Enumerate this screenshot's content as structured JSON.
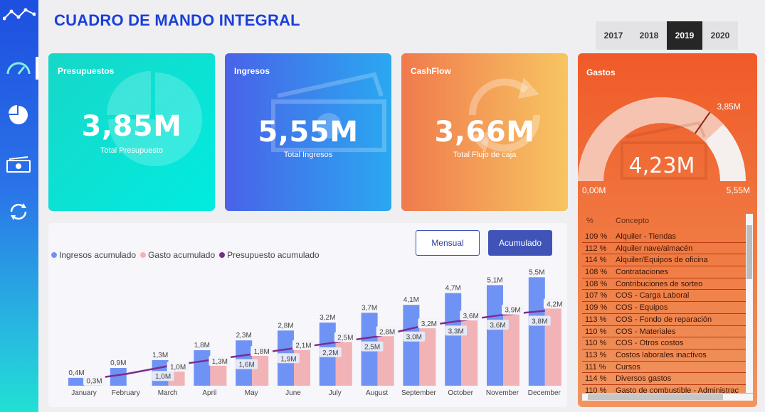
{
  "title": "CUADRO DE MANDO INTEGRAL",
  "years": [
    {
      "label": "2017",
      "active": false
    },
    {
      "label": "2018",
      "active": false
    },
    {
      "label": "2019",
      "active": true
    },
    {
      "label": "2020",
      "active": false
    }
  ],
  "sidebar": {
    "items": [
      {
        "icon": "line-chart-icon"
      },
      {
        "icon": "gauge-icon"
      },
      {
        "icon": "pie-chart-icon"
      },
      {
        "icon": "money-icon"
      },
      {
        "icon": "refresh-icon"
      }
    ]
  },
  "cards": {
    "presupuestos": {
      "title": "Presupuestos",
      "value": "3,85M",
      "subtitle": "Total Presupuesto",
      "icon": "pie-chart-icon"
    },
    "ingresos": {
      "title": "Ingresos",
      "value": "5,55M",
      "subtitle": "Total Ingresos",
      "icon": "money-icon"
    },
    "cashflow": {
      "title": "CashFlow",
      "value": "3,66M",
      "subtitle": "Total Flujo de caja",
      "icon": "refresh-icon"
    }
  },
  "gastos": {
    "title": "Gastos",
    "value": "4,23M",
    "min": "0,00M",
    "max": "5,55M",
    "target": "3,85M",
    "gauge": {
      "value": 4.23,
      "min": 0,
      "max": 5.55,
      "target": 3.85
    },
    "table": {
      "headers": [
        "%",
        "Concepto"
      ],
      "rows": [
        {
          "pct": "109 %",
          "concept": "Alquiler - Tiendas"
        },
        {
          "pct": "112 %",
          "concept": "Alquiler nave/almacén"
        },
        {
          "pct": "114 %",
          "concept": "Alquiler/Equipos de oficina"
        },
        {
          "pct": "108 %",
          "concept": "Contrataciones"
        },
        {
          "pct": "108 %",
          "concept": "Contribuciones de sorteo"
        },
        {
          "pct": "107 %",
          "concept": "COS - Carga Laboral"
        },
        {
          "pct": "109 %",
          "concept": "COS - Equipos"
        },
        {
          "pct": "113 %",
          "concept": "COS - Fondo de reparación"
        },
        {
          "pct": "110 %",
          "concept": "COS - Materiales"
        },
        {
          "pct": "110 %",
          "concept": "COS - Otros costos"
        },
        {
          "pct": "113 %",
          "concept": "Costos laborales inactivos"
        },
        {
          "pct": "111 %",
          "concept": "Cursos"
        },
        {
          "pct": "114 %",
          "concept": "Diversos gastos"
        },
        {
          "pct": "110 %",
          "concept": "Gasto de combustible - Administrac"
        }
      ]
    }
  },
  "chart_controls": {
    "mensual": "Mensual",
    "acumulado": "Acumulado",
    "active": "Acumulado"
  },
  "colors": {
    "ingresos": "#6f93f5",
    "gasto": "#f2b3b6",
    "presupuesto": "#7b2d8e"
  },
  "chart_data": {
    "type": "bar",
    "categories": [
      "January",
      "February",
      "March",
      "April",
      "May",
      "June",
      "July",
      "August",
      "September",
      "October",
      "November",
      "December"
    ],
    "series": [
      {
        "name": "Ingresos acumulado",
        "type": "bar",
        "values": [
          0.4,
          0.9,
          1.3,
          1.8,
          2.3,
          2.8,
          3.2,
          3.7,
          4.1,
          4.7,
          5.1,
          5.5
        ],
        "labels": [
          "0,4M",
          "0,9M",
          "1,3M",
          "1,8M",
          "2,3M",
          "2,8M",
          "3,2M",
          "3,7M",
          "4,1M",
          "4,7M",
          "5,1M",
          "5,5M"
        ]
      },
      {
        "name": "Gasto acumulado",
        "type": "bar",
        "values": [
          0.3,
          null,
          1.0,
          1.3,
          1.8,
          2.1,
          2.5,
          2.8,
          3.2,
          3.6,
          3.9,
          4.2
        ],
        "labels": [
          "0,3M",
          "",
          "1,0M",
          "1,3M",
          "1,8M",
          "2,1M",
          "2,5M",
          "2,8M",
          "3,2M",
          "3,6M",
          "3,9M",
          "4,2M"
        ]
      },
      {
        "name": "Presupuesto acumulado",
        "type": "line",
        "values": [
          0.3,
          0.6,
          1.0,
          1.3,
          1.6,
          1.9,
          2.2,
          2.5,
          3.0,
          3.3,
          3.6,
          3.8
        ],
        "labels": [
          "",
          "",
          "1,0M",
          "",
          "1,6M",
          "1,9M",
          "2,2M",
          "2,5M",
          "3,0M",
          "3,3M",
          "3,6M",
          "3,8M"
        ]
      }
    ],
    "ylim": [
      0,
      5.8
    ],
    "legend": "top-left",
    "grid": false
  }
}
